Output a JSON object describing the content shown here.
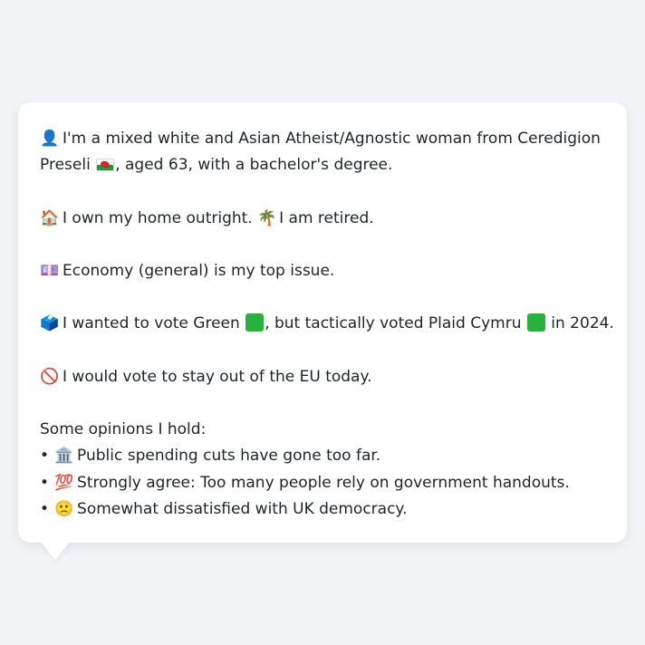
{
  "profile": {
    "line1_icon": "👤",
    "line1_text": "I'm a mixed white and Asian Atheist/Agnostic woman from Ceredigion",
    "line2_text_a": "Preseli",
    "line2_text_b": ", aged 63, with a bachelor's degree.",
    "flag_icon": "wales-flag-icon"
  },
  "home": {
    "icon_home": "🏠",
    "text_a": "I own my home outright.",
    "icon_retired": "🌴",
    "text_b": "I am retired."
  },
  "issue": {
    "icon": "💷",
    "text": "Economy (general) is my top issue."
  },
  "vote": {
    "icon": "🗳️",
    "text_a": "I wanted to vote Green",
    "text_b": ", but tactically voted Plaid Cymru",
    "text_c": "in 2024.",
    "green_color": "#27b33b"
  },
  "eu": {
    "icon": "🚫",
    "text": "I would vote to stay out of the EU today."
  },
  "opinions": {
    "heading": "Some opinions I hold:",
    "bullet": "•",
    "items": [
      {
        "icon": "🏛️",
        "text": "Public spending cuts have gone too far."
      },
      {
        "icon": "💯",
        "text": "Strongly agree: Too many people rely on government handouts."
      },
      {
        "icon": "🙁",
        "text": "Somewhat dissatisfied with UK democracy."
      }
    ]
  }
}
